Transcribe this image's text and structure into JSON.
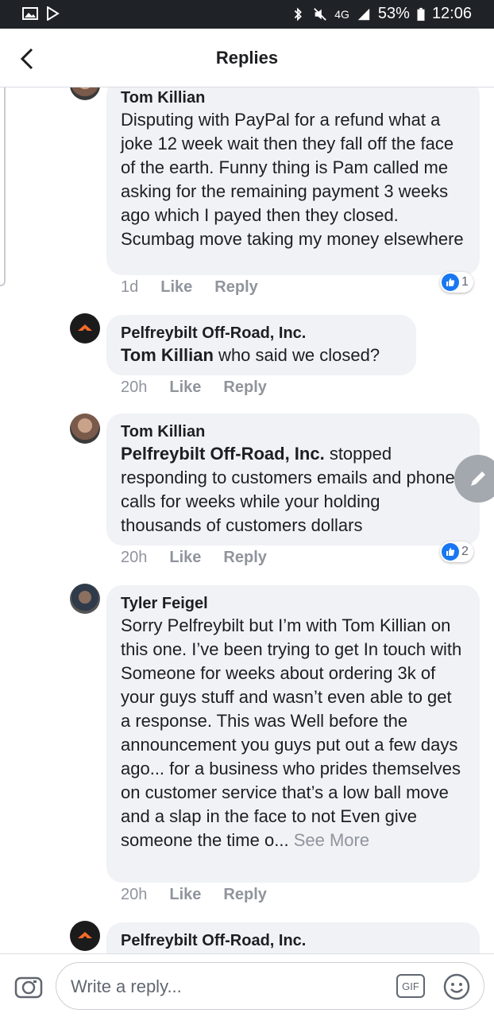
{
  "status_bar": {
    "network": "4G",
    "battery": "53%",
    "time": "12:06",
    "icons": [
      "gallery-icon",
      "play-store-icon",
      "bluetooth-icon",
      "mute-icon",
      "signal-icon",
      "battery-icon"
    ]
  },
  "header": {
    "title": "Replies",
    "back_icon": "chevron-left-icon"
  },
  "comments": [
    {
      "author": "Tom Killian",
      "text": "Disputing with PayPal for a refund what a joke 12 week wait then they fall off the face of the earth. Funny thing is Pam called me asking for the remaining payment 3 weeks ago which I payed then they closed. Scumbag move taking my money elsewhere",
      "time": "1d",
      "like_label": "Like",
      "reply_label": "Reply",
      "reactions": "1"
    },
    {
      "author": "Pelfreybilt Off-Road, Inc.",
      "mention": "Tom Killian",
      "text": " who said we closed?",
      "time": "20h",
      "like_label": "Like",
      "reply_label": "Reply"
    },
    {
      "author": "Tom Killian",
      "mention": "Pelfreybilt Off-Road, Inc.",
      "text": "  stopped responding to customers emails and phone calls for weeks while your holding thousands of customers dollars",
      "time": "20h",
      "like_label": "Like",
      "reply_label": "Reply",
      "reactions": "2"
    },
    {
      "author": "Tyler Feigel",
      "text": "Sorry Pelfreybilt but I’m with Tom Killian on this one. I’ve been trying to get In touch with Someone for weeks about ordering 3k of your guys stuff and wasn’t even able to get a response. This was Well before the announcement you guys put out a few days ago... for a business who prides themselves on customer service that’s a low ball move and a slap in the face to not Even give someone the time o...",
      "see_more": "See More",
      "time": "20h",
      "like_label": "Like",
      "reply_label": "Reply"
    },
    {
      "author": "Pelfreybilt Off-Road, Inc."
    }
  ],
  "reply_bar": {
    "placeholder": "Write a reply...",
    "gif_label": "GIF",
    "camera_icon": "camera-icon",
    "emoji_icon": "emoji-icon"
  },
  "colors": {
    "status_bar_bg": "#1f2226",
    "bubble_bg": "#f0f2f5",
    "like_blue": "#1877f2",
    "meta_gray": "#90949c"
  }
}
